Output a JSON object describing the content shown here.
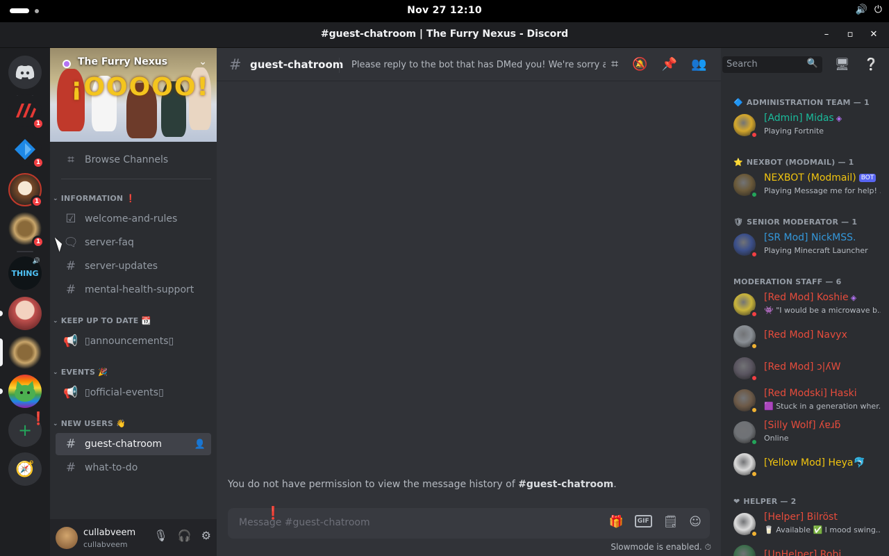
{
  "system": {
    "clock": "Nov 27  12:10",
    "volume_icon": "volume-icon",
    "power_icon": "power-icon"
  },
  "window": {
    "title": "#guest-chatroom | The Furry Nexus - Discord",
    "minimize": "–",
    "maximize": "▫",
    "close": "✕"
  },
  "servers": {
    "home_glyph": "◕",
    "badges": [
      "1",
      "1",
      "1",
      "1"
    ],
    "thing_label": "THING"
  },
  "guild": {
    "name": "The Furry Nexus",
    "banner_text": "¡OOOOO!",
    "browse_channels": "Browse Channels",
    "categories": {
      "information": "INFORMATION ❗",
      "keep_up": "KEEP UP TO DATE 📆",
      "events": "EVENTS 🎉",
      "new_users": "NEW USERS 👋"
    },
    "channels": {
      "welcome": "welcome-and-rules",
      "faq": "server-faq",
      "updates": "server-updates",
      "mental": "mental-health-support",
      "announcements": "▯announcements▯",
      "official_events": "▯official-events▯",
      "guest": "guest-chatroom",
      "what_to_do": "what-to-do"
    }
  },
  "user": {
    "display_name": "cullabveem",
    "username": "cullabveem"
  },
  "chat": {
    "channel_name": "guest-chatroom",
    "topic": "Please reply to the bot that has DMed you! We're sorry abo...",
    "no_permission_prefix": "You do not have permission to view the message history of ",
    "no_permission_channel": "#guest-chatroom",
    "no_permission_suffix": ".",
    "placeholder": "Message #guest-chatroom",
    "gif_label": "GIF",
    "slowmode": "Slowmode is enabled."
  },
  "search": {
    "placeholder": "Search"
  },
  "members": {
    "roles": [
      {
        "label": "ADMINISTRATION TEAM — 1"
      },
      {
        "label": "NEXBOT (MODMAIL) — 1"
      },
      {
        "label": "SENIOR MODERATOR — 1"
      },
      {
        "label": "MODERATION STAFF — 6"
      },
      {
        "label": "HELPER — 2"
      }
    ],
    "list": [
      {
        "name": "[Admin] Midas",
        "sub": "Playing Fortnite",
        "color": "#1abc9c",
        "status": "#f23f43",
        "avatar": "#d4a72c"
      },
      {
        "name": "NEXBOT (Modmail)",
        "bot": "BOT",
        "sub": "Playing Message me for help! ...",
        "color": "#f1c40f",
        "status": "#23a55a",
        "avatar": "#6b5a3a"
      },
      {
        "name": "[SR Mod] NickMSS.",
        "sub": "Playing Minecraft Launcher",
        "color": "#3498db",
        "status": "#f23f43",
        "avatar": "#3b4f8a"
      },
      {
        "name": "[Red Mod] Koshie",
        "sub": "👾 \"I would be a microwave b...",
        "color": "#e74c3c",
        "status": "#f23f43",
        "avatar": "#c9b43b"
      },
      {
        "name": "[Red Mod] Navyx",
        "sub": "",
        "color": "#e74c3c",
        "status": "#f0b232",
        "avatar": "#8a8f95"
      },
      {
        "name": "[Red Mod] ↄ|ʎW",
        "sub": "",
        "color": "#e74c3c",
        "status": "#f23f43",
        "avatar": "#5a5560"
      },
      {
        "name": "[Red Modski] Haski",
        "sub": "🟪 Stuck in a generation wher...",
        "color": "#e74c3c",
        "status": "#f0b232",
        "avatar": "#6d5a48"
      },
      {
        "name": "[Silly Wolf] ʎɐɹƃ",
        "sub": "Online",
        "color": "#e74c3c",
        "status": "#23a55a",
        "avatar": "#6f7276"
      },
      {
        "name": "[Yellow Mod] Heya🐬",
        "sub": "",
        "color": "#f1c40f",
        "status": "#f0b232",
        "avatar": "#d9d9d9"
      },
      {
        "name": "[Helper] Bilröst",
        "sub": "🥛 Available ✅ I mood swing...",
        "color": "#e74c3c",
        "status": "#f0b232",
        "avatar": "#dcdcdc"
      },
      {
        "name": "[UnHelper] Robi",
        "sub": "",
        "color": "#e74c3c",
        "status": "#23a55a",
        "avatar": "#3d6e4c"
      }
    ]
  }
}
